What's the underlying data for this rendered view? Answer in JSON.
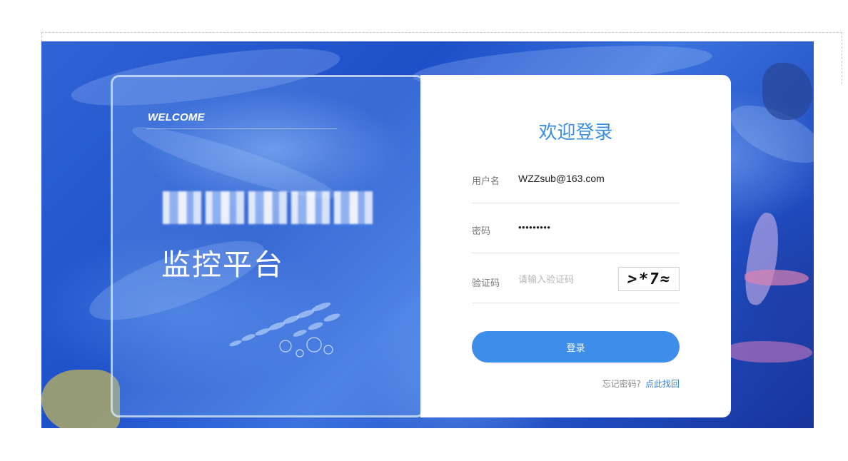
{
  "banner": {
    "welcome": "WELCOME",
    "title_line1_blurred": "",
    "title_line2": "监控平台"
  },
  "login": {
    "title": "欢迎登录",
    "username_label": "用户名",
    "username_value": "WZZsub@163.com",
    "password_label": "密码",
    "password_value": "•••••••••",
    "captcha_label": "验证码",
    "captcha_placeholder": "请输入验证码",
    "captcha_image_text": ">*7≈",
    "submit_label": "登录",
    "forgot_text": "忘记密码?",
    "forgot_link": "点此找回"
  },
  "colors": {
    "accent": "#3c8ee8",
    "title_blue": "#3a8ee6",
    "link_blue": "#2f7fdc"
  }
}
